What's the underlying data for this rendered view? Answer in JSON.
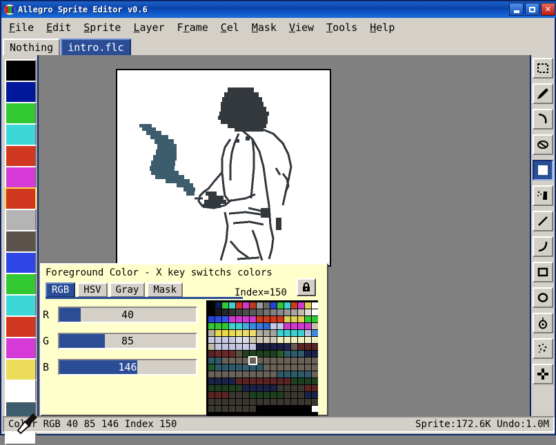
{
  "window": {
    "title": "Allegro Sprite Editor v0.6",
    "app_icon": "allegro-logo-icon",
    "buttons": {
      "minimize": "minimize-button",
      "maximize": "maximize-button",
      "close": "close-button"
    }
  },
  "menubar": {
    "items": [
      {
        "label": "File",
        "accel": "F"
      },
      {
        "label": "Edit",
        "accel": "E"
      },
      {
        "label": "Sprite",
        "accel": "S"
      },
      {
        "label": "Layer",
        "accel": "L"
      },
      {
        "label": "Frame",
        "accel": "r"
      },
      {
        "label": "Cel",
        "accel": "C"
      },
      {
        "label": "Mask",
        "accel": "M"
      },
      {
        "label": "View",
        "accel": "V"
      },
      {
        "label": "Tools",
        "accel": "T"
      },
      {
        "label": "Help",
        "accel": "H"
      }
    ]
  },
  "tabs": [
    {
      "label": "Nothing",
      "active": false
    },
    {
      "label": "intro.flc",
      "active": true
    }
  ],
  "toolbar": {
    "tools": [
      {
        "name": "marquee-select-tool",
        "selected": false
      },
      {
        "name": "pencil-tool",
        "selected": false
      },
      {
        "name": "curve-tool",
        "selected": false
      },
      {
        "name": "eraser-tool",
        "selected": false
      },
      {
        "name": "dither-fill-tool",
        "selected": true
      },
      {
        "name": "spray-tool",
        "selected": false
      },
      {
        "name": "line-tool",
        "selected": false
      },
      {
        "name": "arc-tool",
        "selected": false
      },
      {
        "name": "rectangle-tool",
        "selected": false
      },
      {
        "name": "ellipse-tool",
        "selected": false
      },
      {
        "name": "paint-bucket-tool",
        "selected": false
      },
      {
        "name": "blur-tool",
        "selected": false
      },
      {
        "name": "move-tool",
        "selected": false
      }
    ]
  },
  "palette_strip": {
    "colors": [
      "#000000",
      "#00199c",
      "#32c832",
      "#3dd7d7",
      "#d13820",
      "#d63ad6",
      "#d13820",
      "#b4b4b4",
      "#5c544c",
      "#2e46e8",
      "#32c832",
      "#3dd7d7",
      "#d13820",
      "#d63ad6",
      "#ebdc5c",
      "#ffffff",
      "#3d5c6e",
      "#ffffff"
    ],
    "selected_index": 6,
    "picked_index": 16,
    "cursor": "eyedropper-cursor"
  },
  "dialog": {
    "title": "Foreground Color - X key switchs colors",
    "tabs": [
      {
        "label": "RGB",
        "active": true
      },
      {
        "label": "HSV",
        "active": false
      },
      {
        "label": "Gray",
        "active": false
      },
      {
        "label": "Mask",
        "active": false
      }
    ],
    "index_label": "Index=150",
    "lock_button": "lock-icon",
    "sliders": [
      {
        "label": "R",
        "value": 40,
        "max": 255
      },
      {
        "label": "G",
        "value": 85,
        "max": 255
      },
      {
        "label": "B",
        "value": 146,
        "max": 255
      }
    ],
    "palette_grid": {
      "columns": 16,
      "rows": 16,
      "selected_cell": {
        "row": 8,
        "col": 6
      },
      "colors": [
        "#000000",
        "#101d52",
        "#33c833",
        "#3dd0d0",
        "#d03a1f",
        "#d13ad1",
        "#c03a1f",
        "#9a9a9a",
        "#6a6a6a",
        "#2344d6",
        "#33c833",
        "#3dd0d0",
        "#d03a1f",
        "#d13ad1",
        "#e0d055",
        "#ffffff",
        "#000000",
        "#1a1a1a",
        "#262626",
        "#333333",
        "#404040",
        "#4d4d4d",
        "#595959",
        "#666666",
        "#737373",
        "#808080",
        "#8c8c8c",
        "#999999",
        "#a6a6a6",
        "#c4bdae",
        "#e0dcd2",
        "#ffffff",
        "#2344d6",
        "#2a4de0",
        "#3355e8",
        "#d13ad1",
        "#d13ad1",
        "#d13ad1",
        "#d13ad1",
        "#d03a1f",
        "#d03a1f",
        "#d03a1f",
        "#d03a1f",
        "#e0d055",
        "#e0d055",
        "#e0d055",
        "#33c833",
        "#33c833",
        "#33c833",
        "#33c833",
        "#33c833",
        "#3dd0d0",
        "#3dd0d0",
        "#4aa8e0",
        "#3a8ae0",
        "#3a7ae0",
        "#2a6ad6",
        "#c4c8e8",
        "#c4c8e8",
        "#d13ad1",
        "#d13ad1",
        "#d13ad1",
        "#d13ad1",
        "#c8bfa8",
        "#b4b0a4",
        "#e8d84a",
        "#e8d84a",
        "#e8d84a",
        "#ecdc6a",
        "#ecdc6a",
        "#ecdc6a",
        "#b0aca0",
        "#a8a49a",
        "#a8a49a",
        "#3dd0d0",
        "#3dd0d0",
        "#3dd0d0",
        "#3dd0d0",
        "#b8c0d8",
        "#3a8ae0",
        "#c4c8e0",
        "#c4c8e0",
        "#c4c8e0",
        "#c4c8e0",
        "#d8dae8",
        "#d8dae8",
        "#cfc9b8",
        "#cfc9b8",
        "#cfc9b8",
        "#cfc9b8",
        "#f0eec0",
        "#f0eec0",
        "#f0eec0",
        "#f0eec0",
        "#f0eec0",
        "#f0eec0",
        "#c0bba8",
        "#c0c4dc",
        "#c0c4dc",
        "#c0c4dc",
        "#c0c4dc",
        "#c8cce0",
        "#c0c4dc",
        "#181c3c",
        "#181c3c",
        "#1a1e44",
        "#1a1e44",
        "#22264c",
        "#6a5a52",
        "#5a2424",
        "#5a2424",
        "#5a2424",
        "#5a2424",
        "#6a2a2a",
        "#6a2a2a",
        "#6a2a2a",
        "#5a5046",
        "#1f4020",
        "#1f4020",
        "#1f4020",
        "#1f4020",
        "#1f4020",
        "#2d5a2d",
        "#2e5a6a",
        "#2e5a6a",
        "#2e5a6a",
        "#1a2248",
        "#1a2248",
        "#2e5a6a",
        "#2e5a6a",
        "#6a6258",
        "#6a6258",
        "#6a6258",
        "#6a6258",
        "#6a6258",
        "#6a6258",
        "#6a6258",
        "#6a6258",
        "#6a6258",
        "#6a6258",
        "#6a6258",
        "#6a6258",
        "#6a6258",
        "#6a6258",
        "#1f5a2d",
        "#2e5a6a",
        "#2e5a6a",
        "#2e5a6a",
        "#2e5a6a",
        "#3d5c6e",
        "#2e5a6a",
        "#2e5a6a",
        "#6a6258",
        "#6a6258",
        "#6a6258",
        "#6a6258",
        "#6a6258",
        "#6a6258",
        "#6a6258",
        "#6a6258",
        "#6a6258",
        "#6a6258",
        "#6a6258",
        "#6a6258",
        "#6a6258",
        "#6a6258",
        "#6a6258",
        "#6a6258",
        "#6a6258",
        "#6a6258",
        "#2e5a6a",
        "#2e5a6a",
        "#2e5a6a",
        "#2e5a6a",
        "#2e5a6a",
        "#6a6258",
        "#1a2248",
        "#1a2248",
        "#1a2248",
        "#1a2248",
        "#5a2424",
        "#5a2424",
        "#5a2424",
        "#5a2424",
        "#5a2424",
        "#5a2424",
        "#5a2424",
        "#5a2424",
        "#1f4020",
        "#1f4020",
        "#1f4020",
        "#1f4020",
        "#1f4020",
        "#1f4020",
        "#1f4020",
        "#1f4020",
        "#1f4020",
        "#1a2248",
        "#1a2248",
        "#1a2248",
        "#1a2248",
        "#1a2248",
        "#3a3630",
        "#3a3630",
        "#3a3630",
        "#3a3630",
        "#5a2424",
        "#5a2424",
        "#5a2424",
        "#5a2424",
        "#5a2424",
        "#3a3630",
        "#3a3630",
        "#3a3630",
        "#1f4020",
        "#1f4020",
        "#1f4020",
        "#1f4020",
        "#1f4020",
        "#3a3630",
        "#3a3630",
        "#3a3630",
        "#1a2248",
        "#1a2248",
        "#3a3630",
        "#3a3630",
        "#3a3630",
        "#3a3630",
        "#3a3630",
        "#3a3630",
        "#3a3630",
        "#3a3630",
        "#3a3630",
        "#3a3630",
        "#3a3630",
        "#3a3630",
        "#3a3630",
        "#3a3630",
        "#3a3630",
        "#3a3630",
        "#3a3630",
        "#3a3630",
        "#3a3630",
        "#3a3630",
        "#3a3630",
        "#3a3630",
        "#3a3630",
        "#000000",
        "#000000",
        "#000000",
        "#000000",
        "#000000",
        "#000000",
        "#000000",
        "#000000",
        "#ffffff"
      ]
    }
  },
  "canvas": {
    "background": "#ffffff",
    "ink_color": "#33383d",
    "accent_color": "#3d5c6e",
    "description": "pixel-art figure wearing a hat with blue smoke plume"
  },
  "statusbar": {
    "left": "Color RGB 40 85 146 Index 150",
    "right": "Sprite:172.6K Undo:1.0M"
  },
  "colors": {
    "titlebar_blue": "#0a41a8",
    "accent_blue": "#2a4d96",
    "face": "#d4d0c8",
    "workspace": "#808080",
    "dialog_bg": "#ffffcc",
    "current_color": "#285592"
  }
}
